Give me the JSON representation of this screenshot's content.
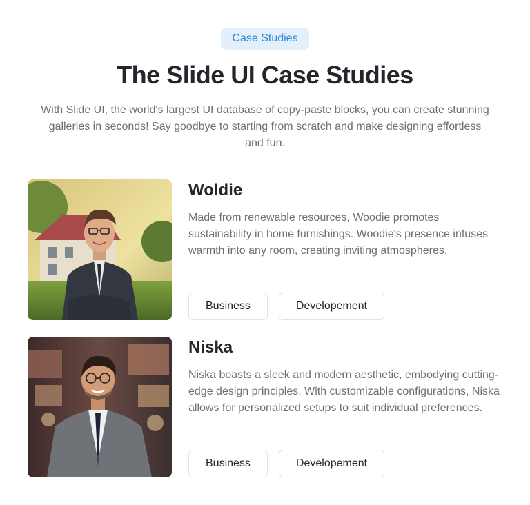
{
  "header": {
    "badge": "Case Studies",
    "title": "The Slide UI Case Studies",
    "subtitle": "With Slide UI, the world's largest UI database of copy-paste blocks, you can create stunning galleries in seconds! Say goodbye to starting from scratch and make designing effortless and fun."
  },
  "cases": [
    {
      "name": "Woldie",
      "description": "Made from renewable resources, Woodie promotes sustainability in home furnishings. Woodie's presence infuses warmth into any room, creating inviting atmospheres.",
      "tags": [
        "Business",
        "Developement"
      ]
    },
    {
      "name": "Niska",
      "description": "Niska boasts a sleek and modern aesthetic, embodying cutting-edge design principles. With customizable configurations, Niska allows for personalized setups to suit individual preferences.",
      "tags": [
        "Business",
        "Developement"
      ]
    }
  ],
  "colors": {
    "badge_bg": "#e3f0fb",
    "badge_text": "#2f86d4",
    "heading": "#23262b",
    "body_text": "#6b6f76"
  }
}
